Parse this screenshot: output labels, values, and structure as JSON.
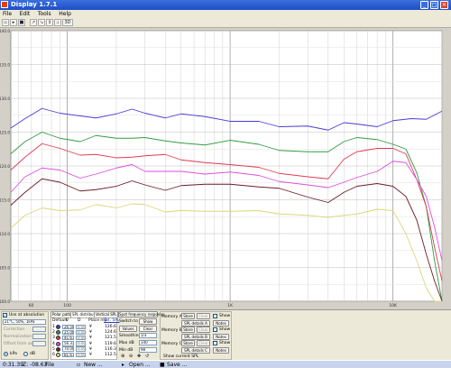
{
  "window": {
    "title": "Display 1.7.1"
  },
  "menu": [
    "File",
    "Edit",
    "Tools",
    "Help"
  ],
  "toolbar": {
    "zoom_label": "3D"
  },
  "chart_data": {
    "type": "line",
    "x_scale": "log",
    "xlim": [
      45,
      20000
    ],
    "ylim": [
      100,
      140
    ],
    "y_ticks": [
      100,
      105,
      110,
      115,
      120,
      125,
      130,
      135,
      140
    ],
    "y_tick_labels": [
      "100.0",
      "105.0",
      "110.0",
      "115.0",
      "120.0",
      "125.0",
      "130.0",
      "135.0",
      "140.0"
    ],
    "x_ticks": [
      60,
      100,
      1000,
      10000
    ],
    "x_tick_labels": [
      "60",
      "100",
      "1K",
      "10K"
    ],
    "grid": true,
    "series": [
      {
        "color": "#4a3ad8",
        "points": [
          [
            45,
            125.6
          ],
          [
            55,
            127
          ],
          [
            70,
            128.5
          ],
          [
            90,
            127.8
          ],
          [
            120,
            127.4
          ],
          [
            150,
            127.1
          ],
          [
            200,
            127.7
          ],
          [
            250,
            128.4
          ],
          [
            300,
            127.8
          ],
          [
            400,
            127.1
          ],
          [
            500,
            127.7
          ],
          [
            700,
            127.3
          ],
          [
            1000,
            126.6
          ],
          [
            1500,
            126.6
          ],
          [
            2000,
            125.8
          ],
          [
            3000,
            125.9
          ],
          [
            4000,
            125.3
          ],
          [
            5000,
            126.4
          ],
          [
            6000,
            126.2
          ],
          [
            8000,
            125.8
          ],
          [
            10000,
            126.7
          ],
          [
            13000,
            127
          ],
          [
            16000,
            126.9
          ],
          [
            20000,
            128.1
          ]
        ]
      },
      {
        "color": "#2f9d42",
        "points": [
          [
            45,
            121.8
          ],
          [
            55,
            123.6
          ],
          [
            70,
            125
          ],
          [
            90,
            124.1
          ],
          [
            120,
            123.6
          ],
          [
            150,
            124.5
          ],
          [
            200,
            124.1
          ],
          [
            250,
            124.1
          ],
          [
            300,
            124.2
          ],
          [
            400,
            123.7
          ],
          [
            500,
            123.4
          ],
          [
            700,
            123.1
          ],
          [
            1000,
            123.8
          ],
          [
            1500,
            123.2
          ],
          [
            2000,
            122.3
          ],
          [
            3000,
            122.1
          ],
          [
            4000,
            122.1
          ],
          [
            5000,
            123.6
          ],
          [
            6000,
            124.2
          ],
          [
            8000,
            123.9
          ],
          [
            10000,
            123.2
          ],
          [
            12000,
            122.5
          ],
          [
            14000,
            119
          ],
          [
            16000,
            114
          ],
          [
            18000,
            106
          ],
          [
            20000,
            98
          ]
        ]
      },
      {
        "color": "#e03a55",
        "points": [
          [
            45,
            119.4
          ],
          [
            55,
            121.3
          ],
          [
            70,
            123.3
          ],
          [
            90,
            122.6
          ],
          [
            120,
            121.6
          ],
          [
            150,
            121.7
          ],
          [
            200,
            121.2
          ],
          [
            250,
            121.3
          ],
          [
            300,
            121.5
          ],
          [
            400,
            121.7
          ],
          [
            500,
            120.9
          ],
          [
            700,
            120.5
          ],
          [
            1000,
            120.2
          ],
          [
            1500,
            119.8
          ],
          [
            2000,
            118.9
          ],
          [
            3000,
            118.4
          ],
          [
            4000,
            118.1
          ],
          [
            5000,
            121
          ],
          [
            6000,
            122.1
          ],
          [
            8000,
            122.6
          ],
          [
            10000,
            122.6
          ],
          [
            12000,
            121.8
          ],
          [
            14000,
            118
          ],
          [
            16000,
            114
          ],
          [
            18000,
            108
          ],
          [
            20000,
            103
          ]
        ]
      },
      {
        "color": "#de4ede",
        "points": [
          [
            45,
            116.1
          ],
          [
            55,
            118.4
          ],
          [
            70,
            119.7
          ],
          [
            90,
            119.4
          ],
          [
            120,
            118.2
          ],
          [
            150,
            118.8
          ],
          [
            200,
            119.7
          ],
          [
            250,
            120.2
          ],
          [
            300,
            119.2
          ],
          [
            400,
            119.2
          ],
          [
            500,
            119.2
          ],
          [
            700,
            118.8
          ],
          [
            1000,
            119.1
          ],
          [
            1500,
            118.6
          ],
          [
            2000,
            117.7
          ],
          [
            3000,
            117.2
          ],
          [
            4000,
            116.8
          ],
          [
            5000,
            117.6
          ],
          [
            6000,
            118.3
          ],
          [
            8000,
            119.2
          ],
          [
            10000,
            120.7
          ],
          [
            12000,
            120.5
          ],
          [
            14000,
            118
          ],
          [
            16000,
            115.5
          ],
          [
            18000,
            111
          ],
          [
            20000,
            106
          ]
        ]
      },
      {
        "color": "#6b1d28",
        "points": [
          [
            45,
            114.2
          ],
          [
            55,
            116.1
          ],
          [
            70,
            118.1
          ],
          [
            90,
            117.6
          ],
          [
            120,
            116.3
          ],
          [
            150,
            116.5
          ],
          [
            200,
            117
          ],
          [
            250,
            117.8
          ],
          [
            300,
            117.2
          ],
          [
            400,
            116.4
          ],
          [
            500,
            117.1
          ],
          [
            700,
            117.3
          ],
          [
            1000,
            117.3
          ],
          [
            1500,
            116.9
          ],
          [
            2000,
            116.7
          ],
          [
            3000,
            115.4
          ],
          [
            4000,
            114.6
          ],
          [
            5000,
            116.1
          ],
          [
            6000,
            117
          ],
          [
            8000,
            117.4
          ],
          [
            10000,
            117
          ],
          [
            12000,
            115.5
          ],
          [
            14000,
            112
          ],
          [
            16000,
            107
          ],
          [
            18000,
            103
          ],
          [
            20000,
            98
          ]
        ]
      },
      {
        "color": "#d8d878",
        "points": [
          [
            45,
            110.8
          ],
          [
            55,
            112.7
          ],
          [
            70,
            113.8
          ],
          [
            90,
            113.4
          ],
          [
            120,
            113.5
          ],
          [
            150,
            114.3
          ],
          [
            200,
            113.8
          ],
          [
            250,
            114.4
          ],
          [
            300,
            114.3
          ],
          [
            400,
            113.2
          ],
          [
            500,
            113.4
          ],
          [
            700,
            113.3
          ],
          [
            1000,
            113.3
          ],
          [
            1500,
            113.4
          ],
          [
            2000,
            112.9
          ],
          [
            3000,
            112.7
          ],
          [
            4000,
            112.4
          ],
          [
            5000,
            112.7
          ],
          [
            6000,
            112.9
          ],
          [
            8000,
            113.6
          ],
          [
            10000,
            113.4
          ],
          [
            12000,
            110
          ],
          [
            14000,
            106
          ],
          [
            16000,
            102
          ],
          [
            18000,
            99.5
          ],
          [
            20000,
            98.5
          ]
        ]
      }
    ]
  },
  "tabs": [
    "Polar pattern",
    "SPL distribution",
    "Vertical SPL"
  ],
  "left_panel": {
    "absolute_label": "Use at absolution",
    "conditions_value": "21°C, 50%, 1kPa",
    "rows": [
      "Correction",
      "Normalization",
      "Offset from axis"
    ],
    "kpa_label": "kPa",
    "db_label": "dB"
  },
  "response": {
    "col_default": "Default",
    "col_v": "V",
    "col_d": "D",
    "col_place": "Place rep",
    "col_tot": "Tot. SPL",
    "rows": [
      {
        "num": "1",
        "color": "#4a3ad8",
        "v": "26.50",
        "d": "0.00",
        "spl": "126.6"
      },
      {
        "num": "2",
        "color": "#2f9d42",
        "v": "25.00",
        "d": "0.00",
        "spl": "124.6"
      },
      {
        "num": "3",
        "color": "#e03a55",
        "v": "41.67",
        "d": "0.00",
        "spl": "121.5"
      },
      {
        "num": "4",
        "color": "#de4ede",
        "v": "56.33",
        "d": "0.00",
        "spl": "119.6"
      },
      {
        "num": "5",
        "color": "#6b1d28",
        "v": "70.00",
        "d": "0.00",
        "spl": "116.3"
      },
      {
        "num": "6",
        "color": "#d8d878",
        "v": "81.67",
        "d": "0.00",
        "spl": "112.5"
      }
    ]
  },
  "switches": {
    "spot_frequency": "Spot frequency response",
    "switch_to": "Switch to",
    "show": "Show",
    "values": "Values",
    "clear": "Clear",
    "smoothing": "Smoothing",
    "smoothing_value": "1/3",
    "max_db": "Max dB",
    "max_db_value": "140",
    "min_db": "Min dB",
    "min_db_value": "98"
  },
  "memories": [
    {
      "label": "Memory A",
      "store": "Store",
      "clear": "Clear",
      "show": "Show",
      "spl_details": "SPL details A",
      "notes": "Notes"
    },
    {
      "label": "Memory B",
      "store": "Store",
      "clear": "Clear",
      "show": "Show",
      "spl_details": "SPL details B",
      "notes": "Notes"
    },
    {
      "label": "Memory C",
      "store": "Store",
      "clear": "Clear",
      "show": "Show",
      "spl_details": "SPL details C",
      "notes": "Notes"
    }
  ],
  "show_current_spl": "Show current SPL",
  "taskbar": {
    "time": "0:31.39",
    "z_readout": "Z: -08.63",
    "items": [
      "File",
      "New ...",
      "Open ...",
      "Save ..."
    ]
  }
}
